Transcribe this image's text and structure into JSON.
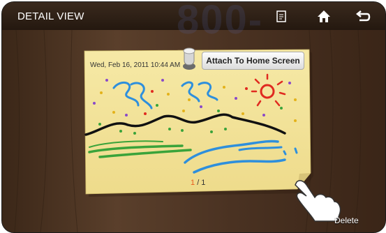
{
  "header": {
    "title": "DETAIL VIEW",
    "icons": [
      "memo-icon",
      "home-icon",
      "back-icon"
    ]
  },
  "watermark": "800-",
  "note": {
    "timestamp": "Wed, Feb 16, 2011 10:44 AM",
    "attach_label": "Attach To Home Screen",
    "page_current": "1",
    "page_total": "/ 1",
    "color": "#f4e59a"
  },
  "delete_label": "Delete",
  "colors": {
    "wood": "#4a3322",
    "note": "#f4e59a",
    "page_current": "#e85b1c"
  }
}
